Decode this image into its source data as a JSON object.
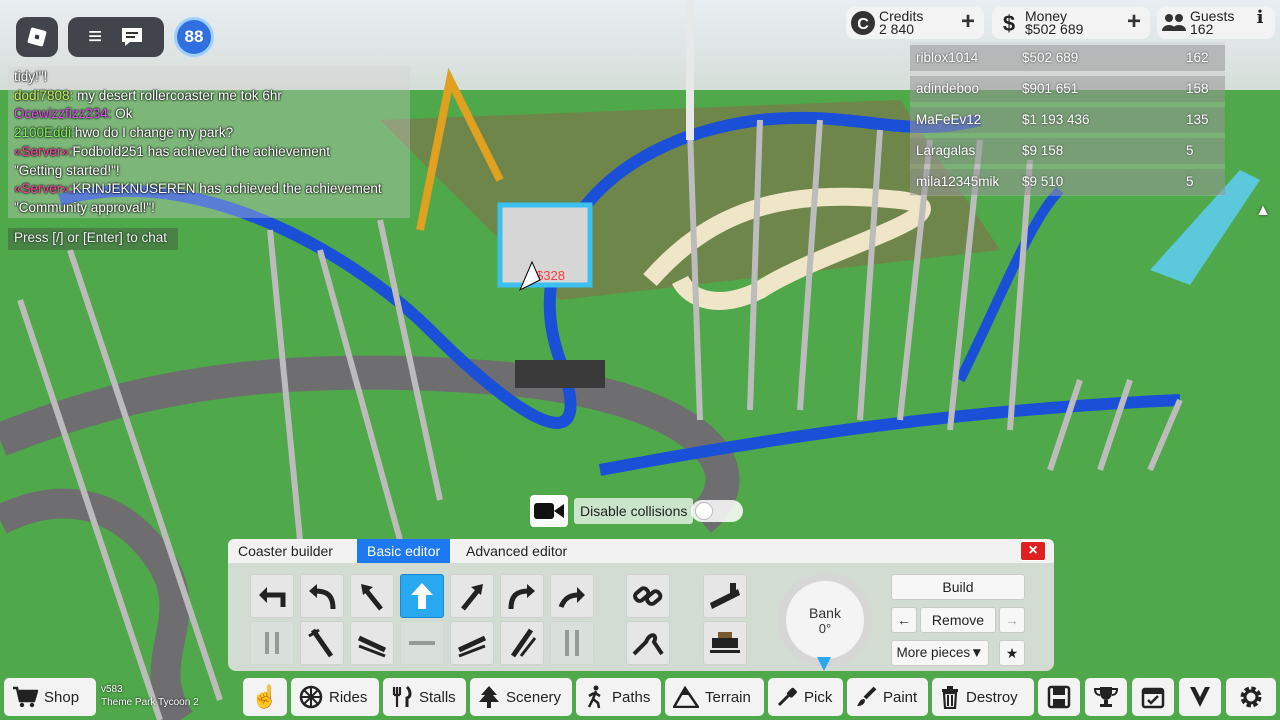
{
  "top_left": {
    "level": "88"
  },
  "chat": {
    "lines": [
      {
        "name": "",
        "text": "tidy!\"!",
        "color": "#ffffff"
      },
      {
        "name": "dodi7808:",
        "text": " my desert rollercoaster me tok 6hr",
        "color": "#c8f060"
      },
      {
        "name": "Ocewizzfizz234:",
        "text": " Ok",
        "color": "#e050f0"
      },
      {
        "name": "2100Eddi:",
        "text": "hwo do I change my park?",
        "color": "#80f060"
      },
      {
        "name": "«Server»:",
        "text": "Fodbold251 has achieved the achievement",
        "color": "#ff40a0"
      },
      {
        "name": "",
        "text": "\"Getting started!\"!",
        "color": "#ffffff"
      },
      {
        "name": "«Server»:",
        "text": "KRINJEKNUSEREN has achieved the achievement",
        "color": "#ff40a0"
      },
      {
        "name": "",
        "text": "\"Community approval!\"!",
        "color": "#ffffff"
      }
    ],
    "hint": "Press [/] or [Enter] to chat"
  },
  "stats": {
    "credits": {
      "label": "Credits",
      "value": "2 840"
    },
    "money": {
      "label": "Money",
      "value": "$502 689"
    },
    "guests": {
      "label": "Guests",
      "value": "162"
    }
  },
  "leaderboard": [
    {
      "name": "riblox1014",
      "money": "$502 689",
      "guests": "162"
    },
    {
      "name": "adindeboo",
      "money": "$901 651",
      "guests": "158"
    },
    {
      "name": "MaFeEv12",
      "money": "$1 193 436",
      "guests": "135"
    },
    {
      "name": "Laragalas",
      "money": "$9 158",
      "guests": "5"
    },
    {
      "name": "mila12345mik",
      "money": "$9 510",
      "guests": "5"
    }
  ],
  "world": {
    "price_tag": "$328"
  },
  "collision": {
    "label": "Disable collisions",
    "enabled": false
  },
  "builder": {
    "title": "Coaster builder",
    "tabs": [
      "Basic editor",
      "Advanced editor"
    ],
    "active_tab": "Basic editor",
    "close": "×",
    "bank_label": "Bank",
    "bank_value": "0°",
    "build": "Build",
    "remove": "Remove",
    "prev": "←",
    "next": "→",
    "more": "More pieces▼",
    "fav": "★"
  },
  "toolbar": {
    "shop": "Shop",
    "version": "v583",
    "game_name": "Theme Park Tycoon 2",
    "rides": "Rides",
    "stalls": "Stalls",
    "scenery": "Scenery",
    "paths": "Paths",
    "terrain": "Terrain",
    "pick": "Pick",
    "paint": "Paint",
    "destroy": "Destroy"
  },
  "colors": {
    "accent": "#1e78f0",
    "track": "#1a4fd8",
    "grass": "#4fa84a",
    "close": "#e02020"
  }
}
